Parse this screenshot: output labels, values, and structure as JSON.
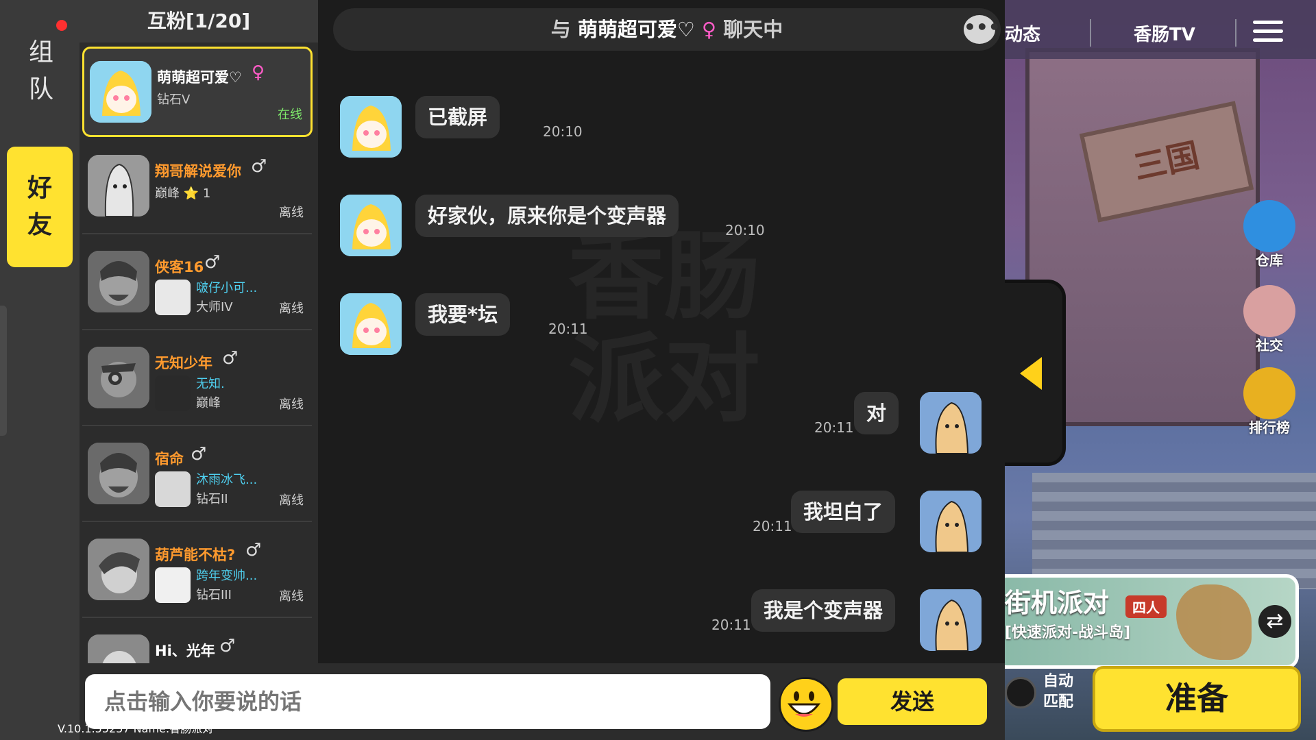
{
  "rail": {
    "team_label": "组队",
    "friends_label": "好友"
  },
  "friends": {
    "header": "互粉[1/20]",
    "items": [
      {
        "name": "萌萌超可爱♡",
        "gender": "♀",
        "rank": "钻石V",
        "status": "在线",
        "selected": true
      },
      {
        "name": "翔哥解说爱你",
        "gender": "♂",
        "rank": "巅峰 ⭐ 1",
        "status": "离线"
      },
      {
        "name": "侠客16",
        "gender": "♂",
        "sub_name": "啵仔小可...",
        "sub_rank": "大师IV",
        "status": "离线"
      },
      {
        "name": "无知少年",
        "gender": "♂",
        "sub_name": "无知.",
        "sub_rank": "巅峰",
        "status": "离线"
      },
      {
        "name": "宿命",
        "gender": "♂",
        "sub_name": "沐雨冰飞...",
        "sub_rank": "钻石II",
        "status": "离线"
      },
      {
        "name": "葫芦能不枯?",
        "gender": "♂",
        "sub_name": "跨年变帅...",
        "sub_rank": "钻石III",
        "status": "离线"
      },
      {
        "name": "Hi、光年",
        "gender": "♂"
      }
    ]
  },
  "chat": {
    "title_prefix": "与",
    "title_name": "萌萌超可爱♡",
    "title_gender": "♀",
    "title_suffix": "聊天中",
    "more_label": "•••",
    "messages": [
      {
        "side": "left",
        "text": "已截屏",
        "time": "20:10"
      },
      {
        "side": "left",
        "text": "好家伙，原来你是个变声器",
        "time": "20:10"
      },
      {
        "side": "left",
        "text": "我要*坛",
        "time": "20:11"
      },
      {
        "side": "right",
        "text": "对",
        "time": "20:11"
      },
      {
        "side": "right",
        "text": "我坦白了",
        "time": "20:11"
      },
      {
        "side": "right",
        "text": "我是个变声器",
        "time": "20:11"
      }
    ],
    "input_placeholder": "点击输入你要说的话",
    "send_label": "发送",
    "version": "V.10.1.55257 Name:香肠派对"
  },
  "game": {
    "nav": {
      "dynamic": "动态",
      "tv": "香肠TV"
    },
    "sign_text": "三国",
    "side_buttons": [
      {
        "label": "仓库",
        "icon": "warehouse-icon"
      },
      {
        "label": "社交",
        "icon": "social-icon"
      },
      {
        "label": "排行榜",
        "icon": "trophy-icon"
      }
    ],
    "mode": {
      "title": "街机派对",
      "badge": "四人",
      "subtitle": "[快速派对-战斗岛]"
    },
    "auto_match": "自动匹配",
    "ready": "准备"
  }
}
